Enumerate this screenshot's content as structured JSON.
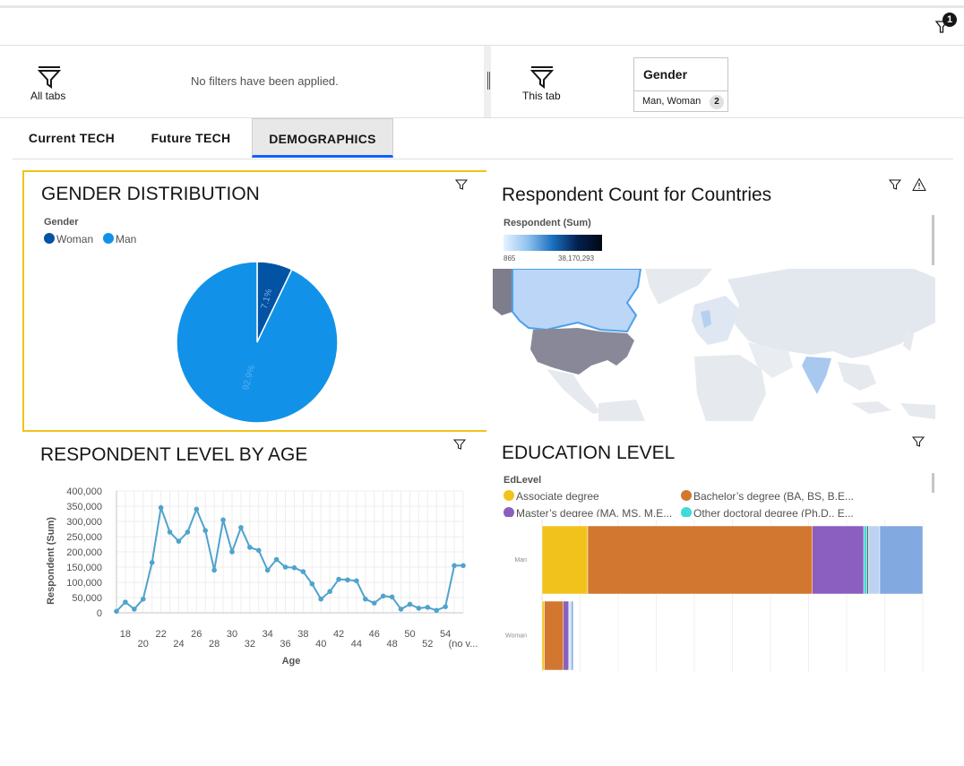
{
  "header": {
    "filter_badge_count": "1"
  },
  "filter_bar": {
    "all_tabs_label": "All tabs",
    "no_filters_text": "No filters have been applied.",
    "this_tab_label": "This tab",
    "gender_filter": {
      "title": "Gender",
      "values": "Man, Woman",
      "count": "2"
    }
  },
  "tabs": [
    {
      "label": "Current TECH",
      "active": false
    },
    {
      "label": "Future TECH",
      "active": false
    },
    {
      "label": "DEMOGRAPHICS",
      "active": true
    }
  ],
  "colors": {
    "accent": "#0f62fe",
    "selected_panel_border": "#f1c21b",
    "woman": "#0353a4",
    "man": "#1192e8",
    "line": "#4fa3cc"
  },
  "gender_panel": {
    "title": "GENDER DISTRIBUTION",
    "legend_title": "Gender",
    "legend": [
      {
        "label": "Woman",
        "color": "#0353a4"
      },
      {
        "label": "Man",
        "color": "#1192e8"
      }
    ]
  },
  "map_panel": {
    "title": "Respondent Count for Countries",
    "legend_title": "Respondent (Sum)",
    "legend_min": "865",
    "legend_max": "38,170,293"
  },
  "age_panel": {
    "title": "RESPONDENT LEVEL BY AGE"
  },
  "education_panel": {
    "title": "EDUCATION LEVEL",
    "legend_title": "EdLevel",
    "legend": [
      {
        "label": "Associate degree",
        "color": "#f1c21b"
      },
      {
        "label": "Bachelor’s degree (BA, BS, B.E...",
        "color": "#d2772f"
      },
      {
        "label": "Master’s degree (MA, MS, M.E...",
        "color": "#8a5fbf"
      },
      {
        "label": "Other doctoral degree (Ph.D., E...",
        "color": "#3ddbd9"
      }
    ]
  },
  "chart_data": [
    {
      "type": "pie",
      "title": "GENDER DISTRIBUTION",
      "categories": [
        "Woman",
        "Man"
      ],
      "values": [
        7.1,
        92.9
      ],
      "labels": [
        "7.1%",
        "92.9%"
      ],
      "colors": [
        "#0353a4",
        "#1192e8"
      ],
      "legend_placement": "top-left"
    },
    {
      "type": "line",
      "title": "RESPONDENT LEVEL BY AGE",
      "xlabel": "Age",
      "ylabel": "Respondent (Sum)",
      "ylim": [
        0,
        400000
      ],
      "yticks": [
        "0",
        "50,000",
        "100,000",
        "150,000",
        "200,000",
        "250,000",
        "300,000",
        "350,000",
        "400,000"
      ],
      "xticks": [
        "18",
        "20",
        "22",
        "24",
        "26",
        "28",
        "30",
        "32",
        "34",
        "36",
        "38",
        "40",
        "42",
        "44",
        "46",
        "48",
        "50",
        "52",
        "54",
        "(no v..."
      ],
      "x": [
        "17",
        "18",
        "19",
        "20",
        "21",
        "22",
        "23",
        "24",
        "25",
        "26",
        "27",
        "28",
        "29",
        "30",
        "31",
        "32",
        "33",
        "34",
        "35",
        "36",
        "37",
        "38",
        "39",
        "40",
        "41",
        "42",
        "43",
        "44",
        "45",
        "46",
        "47",
        "48",
        "49",
        "50",
        "51",
        "52",
        "53",
        "54",
        "55",
        "(no value)"
      ],
      "series": [
        {
          "values": [
            5000,
            35000,
            12000,
            45000,
            165000,
            345000,
            265000,
            235000,
            265000,
            340000,
            270000,
            140000,
            305000,
            200000,
            280000,
            215000,
            205000,
            140000,
            175000,
            150000,
            148000,
            135000,
            95000,
            45000,
            70000,
            110000,
            108000,
            105000,
            45000,
            32000,
            55000,
            52000,
            12000,
            28000,
            15000,
            18000,
            8000,
            20000,
            155000,
            155000
          ]
        }
      ],
      "grid": true
    },
    {
      "type": "bar",
      "title": "EDUCATION LEVEL",
      "orientation": "horizontal",
      "stacked": true,
      "categories": [
        "Man",
        "Woman"
      ],
      "series": [
        {
          "name": "Associate degree",
          "color": "#f1c21b",
          "values": [
            12,
            0.6
          ]
        },
        {
          "name": "Bachelor’s degree (BA, BS, B.E...",
          "color": "#d2772f",
          "values": [
            59,
            5
          ]
        },
        {
          "name": "Master’s degree (MA, MS, M.E...",
          "color": "#8a5fbf",
          "values": [
            13.5,
            1.4
          ]
        },
        {
          "name": "Other doctoral degree (Ph.D., E...",
          "color": "#3ddbd9",
          "values": [
            0.8,
            0.2
          ]
        },
        {
          "color": "#5a5a5a",
          "values": [
            0.4,
            0.1
          ]
        },
        {
          "color": "#bcd2f2",
          "values": [
            3,
            0.4
          ]
        },
        {
          "color": "#82a9e0",
          "values": [
            11.3,
            0.5
          ]
        }
      ],
      "legend_placement": "top"
    }
  ]
}
